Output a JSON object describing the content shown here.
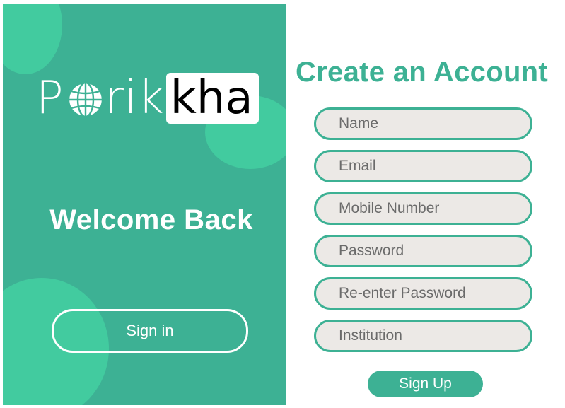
{
  "colors": {
    "brand": "#3db194",
    "brand_light": "#42cb9f",
    "field_bg": "#ece9e6"
  },
  "logo": {
    "part1": "P",
    "part1b": "rik",
    "part2": "kha"
  },
  "left": {
    "welcome": "Welcome Back",
    "signin_label": "Sign in"
  },
  "right": {
    "title": "Create an Account",
    "fields": [
      {
        "placeholder": "Name"
      },
      {
        "placeholder": "Email"
      },
      {
        "placeholder": "Mobile Number"
      },
      {
        "placeholder": "Password"
      },
      {
        "placeholder": "Re-enter Password"
      },
      {
        "placeholder": "Institution"
      }
    ],
    "signup_label": "Sign Up"
  }
}
